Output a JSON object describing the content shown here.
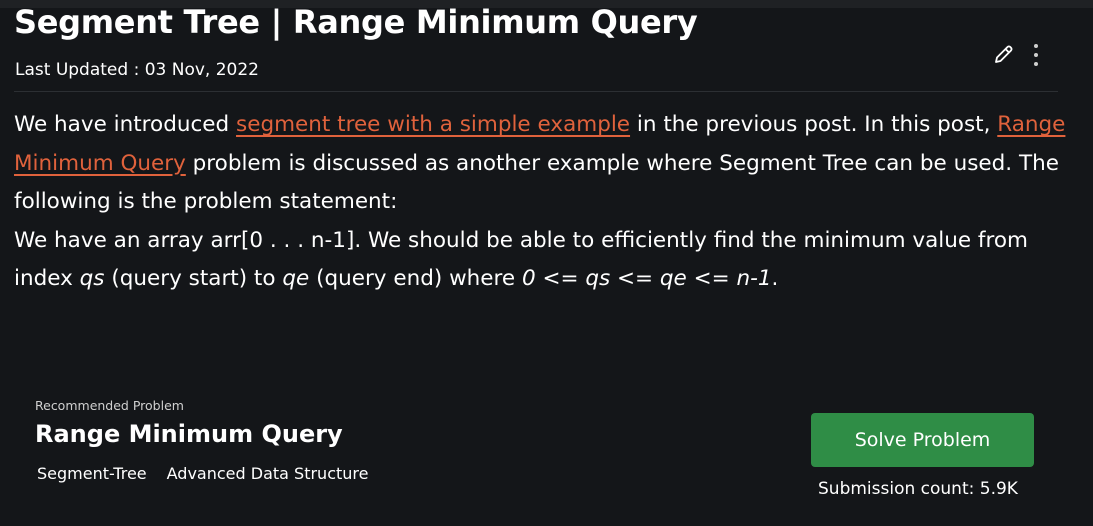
{
  "article": {
    "title": "Segment Tree | Range Minimum Query",
    "last_updated": "Last Updated : 03 Nov, 2022"
  },
  "icons": {
    "edit": "pencil-icon",
    "more": "kebab-menu-icon"
  },
  "content": {
    "p1_text_a": "We have introduced ",
    "p1_link_a": "segment tree with a simple example",
    "p1_text_b": " in the previous post. In this post, ",
    "p1_link_b": "Range Minimum Query",
    "p1_text_c": " problem is discussed as another example where Segment Tree can be used. The following is the problem statement:",
    "p2_text_a": "We have an array arr[0 . . . n-1]. We should be able to efficiently find the minimum value from index ",
    "p2_qs": "qs",
    "p2_text_b": " (query start) to ",
    "p2_qe": "qe",
    "p2_text_c": " (query end) where ",
    "p2_cond": "0 <= qs <= qe <= n-1",
    "p2_text_d": "."
  },
  "recommended": {
    "label": "Recommended Problem",
    "title": "Range Minimum Query",
    "tags": [
      "Segment-Tree",
      "Advanced Data Structure"
    ],
    "button_label": "Solve Problem",
    "submission_count": "Submission count: 5.9K"
  },
  "colors": {
    "background": "#141619",
    "link": "#e0623c",
    "button": "#2f8d46",
    "text": "#ffffff"
  }
}
